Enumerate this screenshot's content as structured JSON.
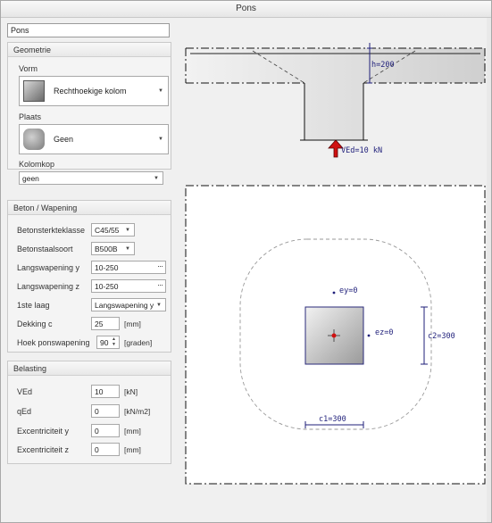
{
  "window": {
    "title": "Pons"
  },
  "name_field": {
    "value": "Pons"
  },
  "geometry": {
    "header": "Geometrie",
    "shape_label": "Vorm",
    "shape_value": "Rechthoekige kolom",
    "plate_label": "Plaats",
    "plate_value": "Geen",
    "head_label": "Kolomkop",
    "head_value": "geen"
  },
  "concrete": {
    "header": "Beton / Wapening",
    "rows": [
      {
        "label": "Betonsterkteklasse",
        "value": "C45/55"
      },
      {
        "label": "Betonstaalsoort",
        "value": "B500B"
      },
      {
        "label": "Langswapening y",
        "value": "10-250"
      },
      {
        "label": "Langswapening z",
        "value": "10-250"
      },
      {
        "label": "1ste laag",
        "value": "Langswapening y"
      },
      {
        "label": "Dekking c",
        "value": "25",
        "unit": "[mm]"
      },
      {
        "label": "Hoek ponswapening",
        "value": "90",
        "unit": "[graden]"
      }
    ]
  },
  "loading": {
    "header": "Belasting",
    "rows": [
      {
        "label": "VEd",
        "value": "10",
        "unit": "[kN]"
      },
      {
        "label": "qEd",
        "value": "0",
        "unit": "[kN/m2]"
      },
      {
        "label": "Excentriciteit y",
        "value": "0",
        "unit": "[mm]"
      },
      {
        "label": "Excentriciteit z",
        "value": "0",
        "unit": "[mm]"
      }
    ]
  },
  "drawing": {
    "h_label": "h=200",
    "ved_label": "VEd=10 kN",
    "ey_label": "ey=0",
    "ez_label": "ez=0",
    "c1_label": "c1=300",
    "c2_label": "c2=300",
    "colors": {
      "dimension": "#1f1f7a",
      "arrow": "#d01010",
      "column_border": "#2a2a7a"
    }
  }
}
